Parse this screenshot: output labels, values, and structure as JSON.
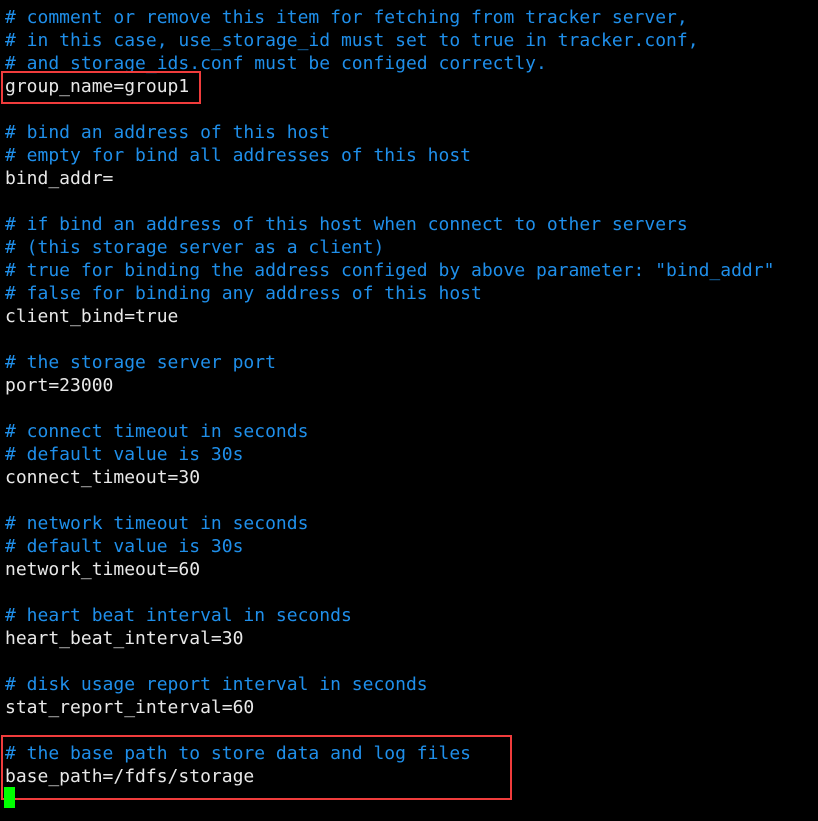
{
  "terminal": {
    "lines": [
      {
        "type": "comment",
        "text": "# comment or remove this item for fetching from tracker server,"
      },
      {
        "type": "comment",
        "text": "# in this case, use_storage_id must set to true in tracker.conf,"
      },
      {
        "type": "comment",
        "text": "# and storage_ids.conf must be configed correctly."
      },
      {
        "type": "setting",
        "text": "group_name=group1"
      },
      {
        "type": "blank",
        "text": ""
      },
      {
        "type": "comment",
        "text": "# bind an address of this host"
      },
      {
        "type": "comment",
        "text": "# empty for bind all addresses of this host"
      },
      {
        "type": "setting",
        "text": "bind_addr="
      },
      {
        "type": "blank",
        "text": ""
      },
      {
        "type": "comment",
        "text": "# if bind an address of this host when connect to other servers"
      },
      {
        "type": "comment",
        "text": "# (this storage server as a client)"
      },
      {
        "type": "comment",
        "text": "# true for binding the address configed by above parameter: \"bind_addr\""
      },
      {
        "type": "comment",
        "text": "# false for binding any address of this host"
      },
      {
        "type": "setting",
        "text": "client_bind=true"
      },
      {
        "type": "blank",
        "text": ""
      },
      {
        "type": "comment",
        "text": "# the storage server port"
      },
      {
        "type": "setting",
        "text": "port=23000"
      },
      {
        "type": "blank",
        "text": ""
      },
      {
        "type": "comment",
        "text": "# connect timeout in seconds"
      },
      {
        "type": "comment",
        "text": "# default value is 30s"
      },
      {
        "type": "setting",
        "text": "connect_timeout=30"
      },
      {
        "type": "blank",
        "text": ""
      },
      {
        "type": "comment",
        "text": "# network timeout in seconds"
      },
      {
        "type": "comment",
        "text": "# default value is 30s"
      },
      {
        "type": "setting",
        "text": "network_timeout=60"
      },
      {
        "type": "blank",
        "text": ""
      },
      {
        "type": "comment",
        "text": "# heart beat interval in seconds"
      },
      {
        "type": "setting",
        "text": "heart_beat_interval=30"
      },
      {
        "type": "blank",
        "text": ""
      },
      {
        "type": "comment",
        "text": "# disk usage report interval in seconds"
      },
      {
        "type": "setting",
        "text": "stat_report_interval=60"
      },
      {
        "type": "blank",
        "text": ""
      },
      {
        "type": "comment",
        "text": "# the base path to store data and log files"
      },
      {
        "type": "setting",
        "text": "base_path=/fdfs/storage"
      }
    ]
  },
  "colors": {
    "background": "#000000",
    "comment": "#1f8fea",
    "setting": "#e8e8e8",
    "highlight_box": "#f03c3c",
    "cursor": "#00ff00"
  }
}
